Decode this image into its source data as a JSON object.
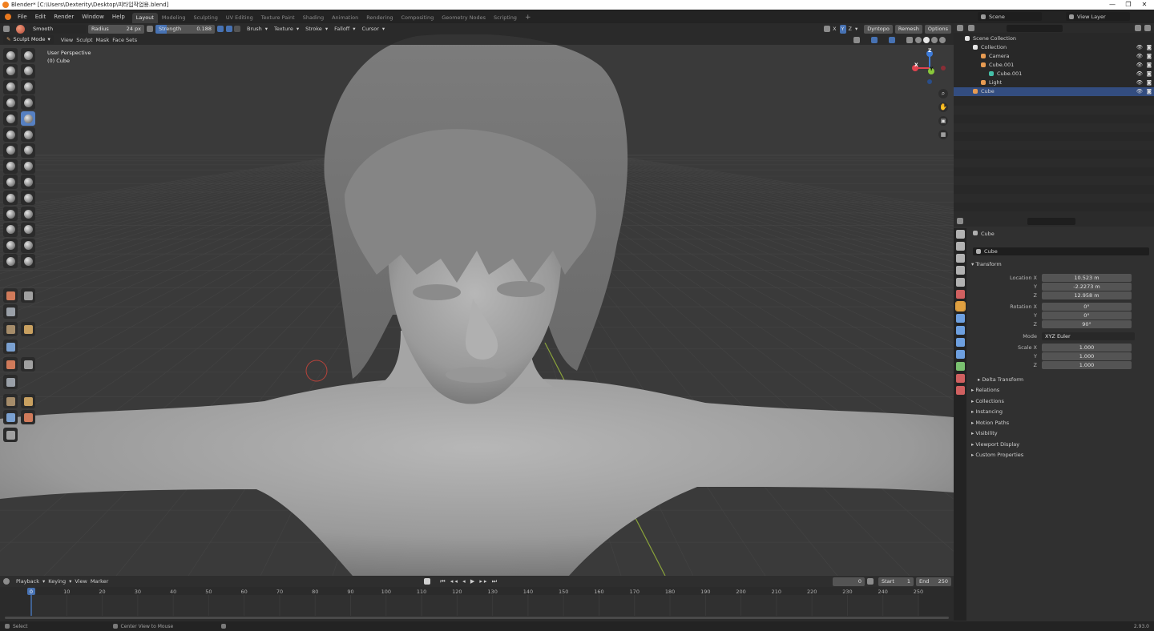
{
  "window": {
    "title": "Blender* [C:\\Users\\Dexterity\\Desktop\\피타입작업용.blend]",
    "controls": [
      "—",
      "❐",
      "✕"
    ]
  },
  "menubar": {
    "items": [
      "File",
      "Edit",
      "Render",
      "Window",
      "Help"
    ],
    "workspaces": [
      "Layout",
      "Modeling",
      "Sculpting",
      "UV Editing",
      "Texture Paint",
      "Shading",
      "Animation",
      "Rendering",
      "Compositing",
      "Geometry Nodes",
      "Scripting"
    ],
    "active_workspace": "Layout",
    "add_tab": "+"
  },
  "scene_selector": {
    "scene": "Scene",
    "view_layer": "View Layer"
  },
  "tool_header": {
    "brush_name": "Smooth",
    "radius_label": "Radius",
    "radius_value": "24 px",
    "strength_label": "Strength",
    "strength_value": "0.188",
    "menus": [
      "Brush",
      "Texture",
      "Stroke",
      "Falloff",
      "Cursor"
    ],
    "axes": [
      "X",
      "Y",
      "Z"
    ],
    "right_menus": [
      "Dyntopo",
      "Remesh",
      "Options"
    ]
  },
  "viewport_header": {
    "mode": "Sculpt Mode",
    "menus": [
      "View",
      "Sculpt",
      "Mask",
      "Face Sets"
    ]
  },
  "viewport": {
    "info_line1": "User Perspective",
    "info_line2": "(0) Cube",
    "gizmo": {
      "x": "X",
      "y": "Y",
      "z": "Z"
    },
    "colors": {
      "background": "#3a3a3a",
      "grid": "#444444",
      "y_axis": "#8aa33a",
      "mesh": "#a9a9a9",
      "x_axis_gizmo": "#e0434f",
      "y_axis_gizmo": "#8ac83b",
      "z_axis_gizmo": "#3d7bd9"
    }
  },
  "toolbar": {
    "tools": [
      "draw-brush",
      "draw-sharp-brush",
      "clay-brush",
      "clay-strips-brush",
      "clay-thumb-brush",
      "layer-brush",
      "inflate-brush",
      "blob-brush",
      "crease-brush",
      "smooth-brush",
      "flatten-brush",
      "fill-brush",
      "scrape-brush",
      "multiplane-scrape-brush",
      "pinch-brush",
      "grab-brush",
      "elastic-deform-brush",
      "snake-hook-brush",
      "thumb-brush",
      "pose-brush",
      "nudge-brush",
      "rotate-brush",
      "slide-relax-brush",
      "boundary-brush",
      "cloth-brush",
      "simplify-brush",
      "mask-brush",
      "draw-face-sets-brush",
      "multires-displacement-eraser",
      "multires-displacement-smear",
      "paint-brush",
      "smear-brush",
      "box-mask-tool",
      "box-hide-tool",
      "box-face-set-tool",
      "box-trim-tool",
      "line-project-tool",
      "mesh-filter-tool",
      "cloth-filter-tool",
      "color-filter-tool",
      "edit-face-set-tool",
      "mask-by-color-tool",
      "move-tool",
      "rotate-tool",
      "scale-tool",
      "transform-tool",
      "annotate-tool"
    ],
    "active": "smooth-brush"
  },
  "outliner": {
    "search_placeholder": "",
    "rows": [
      {
        "label": "Scene Collection",
        "indent": 0,
        "icon": "collection-icon",
        "selected": false
      },
      {
        "label": "Collection",
        "indent": 1,
        "icon": "collection-icon",
        "selected": false
      },
      {
        "label": "Camera",
        "indent": 2,
        "icon": "camera-icon",
        "selected": false
      },
      {
        "label": "Cube.001",
        "indent": 2,
        "icon": "mesh-icon",
        "selected": false
      },
      {
        "label": "Cube.001",
        "indent": 3,
        "icon": "mesh-data-icon",
        "selected": false
      },
      {
        "label": "Light",
        "indent": 2,
        "icon": "light-icon",
        "selected": false
      },
      {
        "label": "Cube",
        "indent": 1,
        "icon": "mesh-icon",
        "selected": true
      }
    ]
  },
  "properties": {
    "object_name": "Cube",
    "object_field": "Cube",
    "transform_label": "Transform",
    "location_label": "Location X",
    "location": [
      "10.523 m",
      "-2.2273 m",
      "12.958 m"
    ],
    "rotation_label": "Rotation X",
    "rotation": [
      "0°",
      "0°",
      "90°"
    ],
    "mode_label": "Mode",
    "mode_value": "XYZ Euler",
    "scale_label": "Scale X",
    "scale": [
      "1.000",
      "1.000",
      "1.000"
    ],
    "axis_labels": [
      "Y",
      "Z"
    ],
    "delta_transform": "Delta Transform",
    "panels": [
      "Relations",
      "Collections",
      "Instancing",
      "Motion Paths",
      "Visibility",
      "Viewport Display",
      "Custom Properties"
    ],
    "tab_colors": [
      "#b2b2b2",
      "#b2b2b2",
      "#b2b2b2",
      "#b2b2b2",
      "#b2b2b2",
      "#d06060",
      "#e0a040",
      "#6ea0e0",
      "#6ea0e0",
      "#6ea0e0",
      "#6ea0e0",
      "#7ac070",
      "#d06060",
      "#d06060"
    ]
  },
  "timeline": {
    "menus": [
      "Playback",
      "Keying",
      "View",
      "Marker"
    ],
    "current_frame": "0",
    "start_label": "Start",
    "start_value": "1",
    "end_label": "End",
    "end_value": "250",
    "ticks": [
      "0",
      "10",
      "20",
      "30",
      "40",
      "50",
      "60",
      "70",
      "80",
      "90",
      "100",
      "110",
      "120",
      "130",
      "140",
      "150",
      "160",
      "170",
      "180",
      "190",
      "200",
      "210",
      "220",
      "230",
      "240",
      "250"
    ],
    "playhead_label": "0"
  },
  "statusbar": {
    "left": "Select",
    "middle": "Center View to Mouse",
    "version": "2.93.0"
  }
}
